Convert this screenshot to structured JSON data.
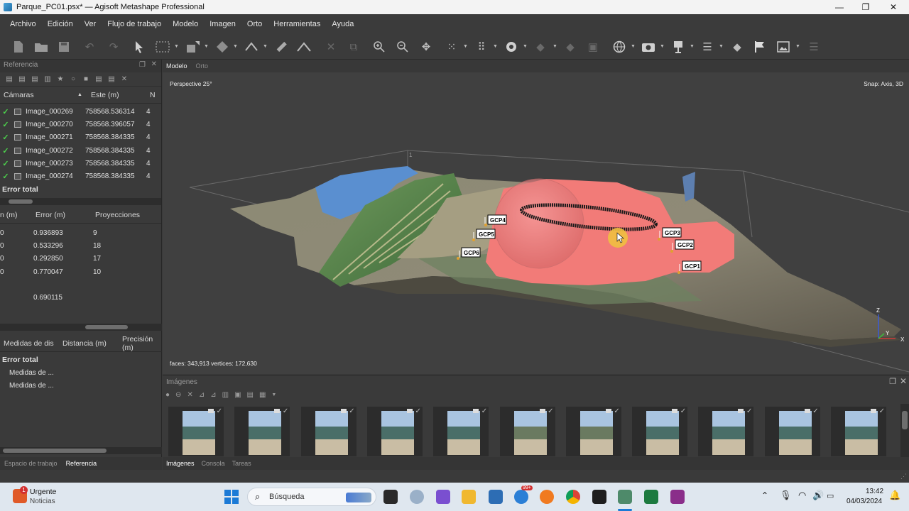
{
  "window": {
    "title": "Parque_PC01.psx* — Agisoft Metashape Professional",
    "min_glyph": "—",
    "max_glyph": "❐",
    "close_glyph": "✕"
  },
  "menu": [
    "Archivo",
    "Edición",
    "Ver",
    "Flujo de trabajo",
    "Modelo",
    "Imagen",
    "Orto",
    "Herramientas",
    "Ayuda"
  ],
  "reference_panel": {
    "title": "Referencia",
    "cameras_header": {
      "col1": "Cámaras",
      "col2": "Este (m)",
      "col3": "N"
    },
    "cameras": [
      {
        "name": "Image_000269",
        "east": "758568.536314",
        "n": "4"
      },
      {
        "name": "Image_000270",
        "east": "758568.396057",
        "n": "4"
      },
      {
        "name": "Image_000271",
        "east": "758568.384335",
        "n": "4"
      },
      {
        "name": "Image_000272",
        "east": "758568.384335",
        "n": "4"
      },
      {
        "name": "Image_000273",
        "east": "758568.384335",
        "n": "4"
      },
      {
        "name": "Image_000274",
        "east": "758568.384335",
        "n": "4"
      }
    ],
    "cameras_total_label": "Error total",
    "markers_header": {
      "col1": "n (m)",
      "col2": "Error (m)",
      "col3": "Proyecciones"
    },
    "markers": [
      {
        "c1": "0",
        "error": "0.936893",
        "proj": "9"
      },
      {
        "c1": "0",
        "error": "0.533296",
        "proj": "18"
      },
      {
        "c1": "0",
        "error": "0.292850",
        "proj": "17"
      },
      {
        "c1": "0",
        "error": "0.770047",
        "proj": "10"
      }
    ],
    "markers_total_error": "0.690115",
    "scale_header": {
      "col1": "Medidas de dis",
      "col2": "Distancia (m)",
      "col3": "Precisión (m)"
    },
    "scale_total_label": "Error total",
    "scale_rows": [
      "Medidas de ...",
      "Medidas de ..."
    ]
  },
  "left_tabs": [
    "Espacio de trabajo",
    "Referencia"
  ],
  "viewport": {
    "tabs": [
      "Modelo",
      "Orto"
    ],
    "projection": "Perspective 25°",
    "snap": "Snap: Axis, 3D",
    "stats": "faces: 343,913 vertices: 172,630",
    "markers": [
      "GCP4",
      "GCP5",
      "GCP6",
      "GCP3",
      "GCP2",
      "GCP1"
    ],
    "axes": {
      "z": "Z",
      "y": "Y",
      "x": "X"
    },
    "tick": "1"
  },
  "images_panel": {
    "title": "Imágenes",
    "thumbnail_count": 11,
    "check_glyph": "✓"
  },
  "images_tabs": [
    "Imágenes",
    "Consola",
    "Tareas"
  ],
  "taskbar": {
    "news_title": "Urgente",
    "news_sub": "Noticias",
    "news_badge": "1",
    "search_placeholder": "Búsqueda",
    "time": "13:42",
    "date": "04/03/2024",
    "notif_badge": "99+"
  }
}
